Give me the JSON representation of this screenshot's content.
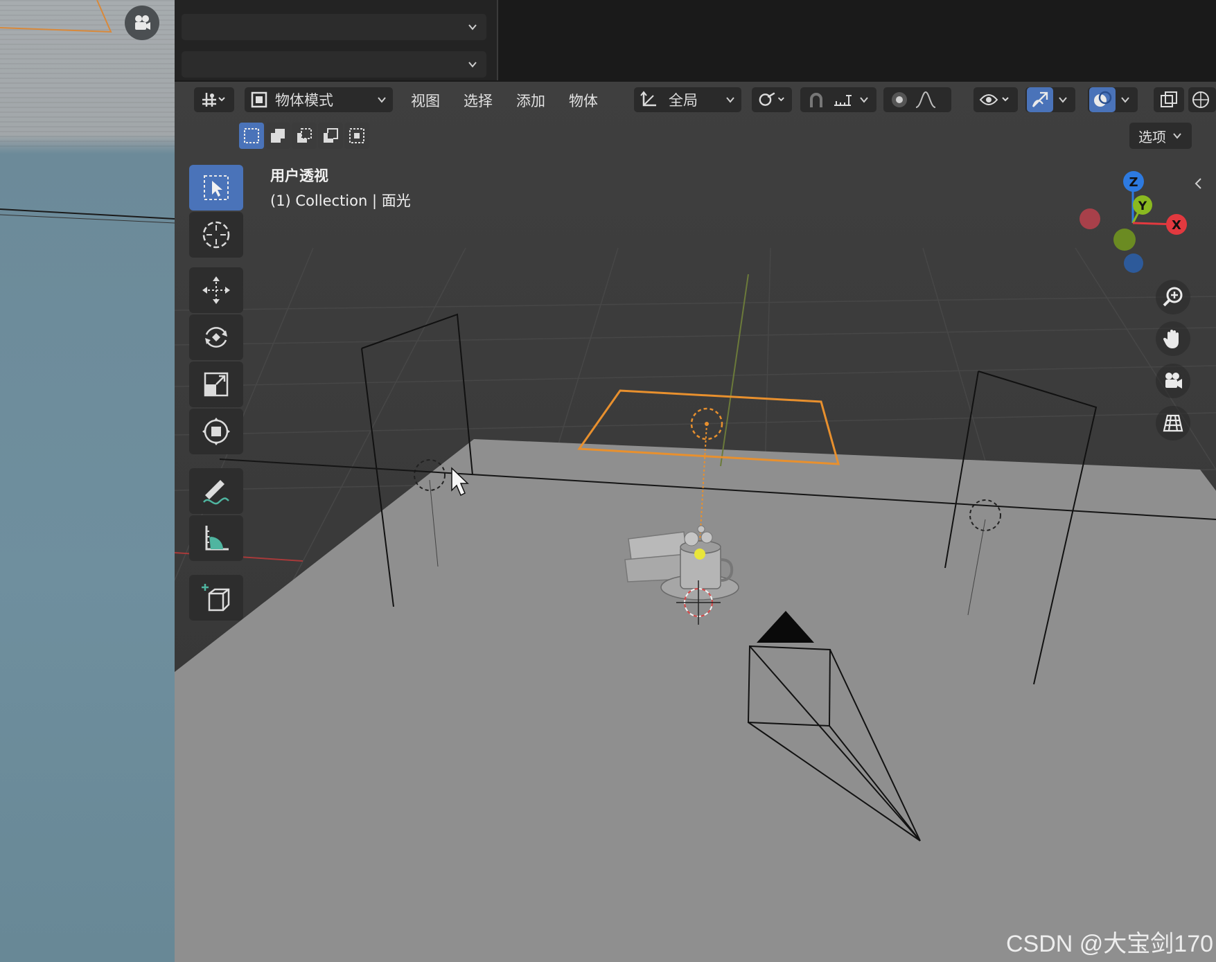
{
  "header": {
    "mode_label": "物体模式",
    "menus": [
      "视图",
      "选择",
      "添加",
      "物体"
    ],
    "transform_orientation": "全局"
  },
  "options_label": "选项",
  "viewport": {
    "title": "用户透视",
    "subtitle": "(1) Collection | 面光"
  },
  "gizmo": {
    "z": "Z",
    "y": "Y",
    "x": "X"
  },
  "colors": {
    "accent_blue": "#4a73b9",
    "selection_orange": "#e8902e",
    "axis_x": "#e2393f",
    "axis_y": "#8ab920",
    "axis_z": "#2d7ae0"
  },
  "icons": {
    "tools": [
      "select-box-icon",
      "cursor-icon",
      "move-icon",
      "rotate-icon",
      "scale-icon",
      "transform-icon",
      "annotate-icon",
      "measure-icon",
      "add-cube-icon"
    ],
    "nav": [
      "zoom-icon",
      "pan-hand-icon",
      "camera-view-icon",
      "ortho-grid-icon"
    ]
  },
  "watermark": "CSDN @大宝剑170"
}
